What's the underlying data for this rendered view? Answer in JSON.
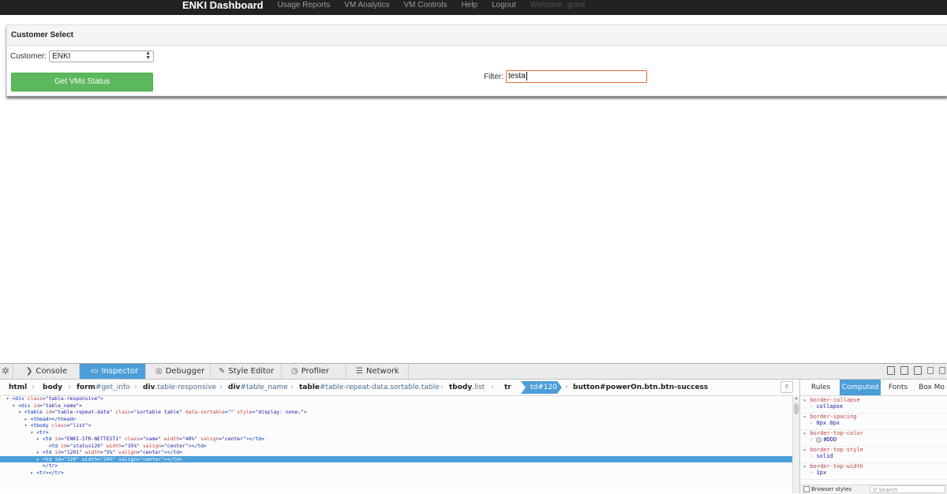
{
  "navbar": {
    "brand": "ENKI Dashboard",
    "links": [
      "Usage Reports",
      "VM Analytics",
      "VM Controls",
      "Help",
      "Logout"
    ],
    "welcome": "Welcome: grant"
  },
  "panel": {
    "heading": "Customer Select",
    "customer_label": "Customer:",
    "customer_value": "ENKI",
    "get_status_button": "Get VMs Status",
    "filter_label": "Filter:",
    "filter_value": "testa"
  },
  "devtools": {
    "tabs": [
      "Console",
      "Inspector",
      "Debugger",
      "Style Editor",
      "Profiler",
      "Network"
    ],
    "active_tab": "Inspector",
    "breadcrumbs": [
      {
        "tag": "html",
        "rest": ""
      },
      {
        "tag": "body",
        "rest": ""
      },
      {
        "tag": "form",
        "rest": "#get_info"
      },
      {
        "tag": "div",
        "rest": ".table-responsive"
      },
      {
        "tag": "div",
        "rest": "#table_name"
      },
      {
        "tag": "table",
        "rest": "#table-repeat-data.sortable.table"
      },
      {
        "tag": "tbody",
        "rest": ".list"
      },
      {
        "tag": "tr",
        "rest": ""
      },
      {
        "tag": "td",
        "rest": "#120"
      },
      {
        "tag": "button",
        "rest": "#powerOn.btn.btn-success"
      }
    ],
    "markup_lines": [
      {
        "indent": "  ",
        "twisty": "▾",
        "tag": "<div",
        "attrs": [
          [
            "class",
            "table-responsive"
          ]
        ],
        "end": ">",
        "selected": false
      },
      {
        "indent": "    ",
        "twisty": "▾",
        "tag": "<div",
        "attrs": [
          [
            "id",
            "table_name"
          ]
        ],
        "end": ">",
        "selected": false
      },
      {
        "indent": "      ",
        "twisty": "▾",
        "tag": "<table",
        "attrs": [
          [
            "id",
            "table-repeat-data"
          ],
          [
            "class",
            "sortable table"
          ],
          [
            "data-sortable",
            ""
          ],
          [
            "style",
            "display: none;"
          ]
        ],
        "end": ">",
        "selected": false
      },
      {
        "indent": "        ",
        "twisty": "▸",
        "tag": "<thead>",
        "attrs": [],
        "end": "</thead>",
        "selected": false
      },
      {
        "indent": "        ",
        "twisty": "▾",
        "tag": "<tbody",
        "attrs": [
          [
            "class",
            "list"
          ]
        ],
        "end": ">",
        "selected": false
      },
      {
        "indent": "          ",
        "twisty": "▾",
        "tag": "<tr>",
        "attrs": [],
        "end": "",
        "selected": false
      },
      {
        "indent": "            ",
        "twisty": "▸",
        "tag": "<td",
        "attrs": [
          [
            "id",
            "ENKI-STR-NETTEST1"
          ],
          [
            "class",
            "name"
          ],
          [
            "width",
            "40%"
          ],
          [
            "valign",
            "center"
          ]
        ],
        "end": "></td>",
        "selected": false
      },
      {
        "indent": "              ",
        "twisty": "",
        "tag": "<td",
        "attrs": [
          [
            "id",
            "status120"
          ],
          [
            "width",
            "35%"
          ],
          [
            "valign",
            "center"
          ]
        ],
        "end": "></td>",
        "selected": false
      },
      {
        "indent": "            ",
        "twisty": "▸",
        "tag": "<td",
        "attrs": [
          [
            "id",
            "1201"
          ],
          [
            "width",
            "5%"
          ],
          [
            "valign",
            "center"
          ]
        ],
        "end": "></td>",
        "selected": false
      },
      {
        "indent": "            ",
        "twisty": "▸",
        "tag": "<td",
        "attrs": [
          [
            "id",
            "120"
          ],
          [
            "width",
            "20%"
          ],
          [
            "valign",
            "center"
          ]
        ],
        "end": "></td>",
        "selected": true
      },
      {
        "indent": "            ",
        "twisty": "",
        "tag": "</tr>",
        "attrs": [],
        "end": "",
        "selected": false
      },
      {
        "indent": "          ",
        "twisty": "▸",
        "tag": "<tr>",
        "attrs": [],
        "end": "</tr>",
        "selected": false
      }
    ],
    "sidebar_tabs": [
      "Rules",
      "Computed",
      "Fonts",
      "Box Mo"
    ],
    "sidebar_active": "Computed",
    "computed": [
      {
        "name": "border-collapse",
        "value": "collapse"
      },
      {
        "name": "border-spacing",
        "value": "0px 0px"
      },
      {
        "name": "border-top-color",
        "value": "#DDD",
        "swatch": "#dddddd"
      },
      {
        "name": "border-top-style",
        "value": "solid"
      },
      {
        "name": "border-top-width",
        "value": "1px"
      }
    ],
    "browser_styles_label": "Browser styles",
    "search_placeholder": "Search"
  }
}
